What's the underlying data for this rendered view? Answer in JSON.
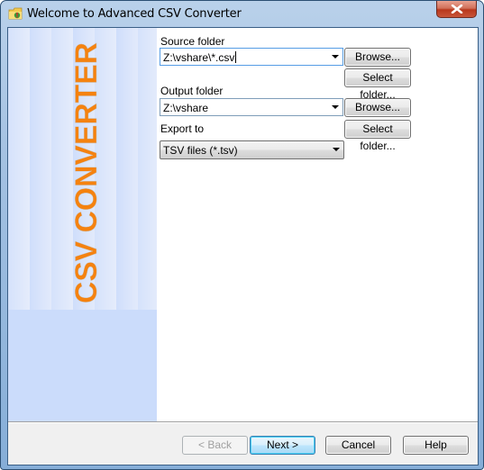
{
  "window": {
    "title": "Welcome to Advanced CSV Converter",
    "app_icon": "folder-app-icon",
    "close_icon": "close-icon"
  },
  "banner": {
    "text": "CSV CONVERTER",
    "text_color": "#f5820f"
  },
  "form": {
    "source_folder": {
      "label": "Source folder",
      "value": "Z:\\vshare\\*.csv",
      "browse_label": "Browse...",
      "select_folder_label": "Select folder..."
    },
    "output_folder": {
      "label": "Output folder",
      "value": "Z:\\vshare",
      "browse_label": "Browse...",
      "select_folder_label": "Select folder..."
    },
    "export_to": {
      "label": "Export to",
      "selected": "TSV files (*.tsv)"
    }
  },
  "footer": {
    "back_label": "< Back",
    "next_label": "Next >",
    "cancel_label": "Cancel",
    "help_label": "Help"
  }
}
